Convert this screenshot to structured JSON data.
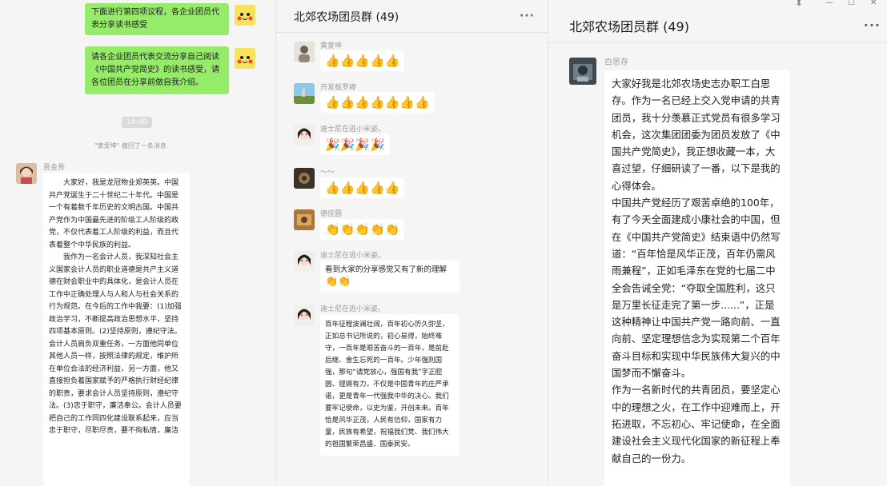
{
  "pane1": {
    "outgoing": [
      {
        "text": "下面进行第四项议程，各企业团员代表分享读书感受"
      },
      {
        "text": "请各企业团员代表交流分享自己阅读《中国共产党简史》的读书感受，请各位团员在分享前做自我介绍。"
      }
    ],
    "time": "14:40",
    "recall": "\"黄爱坤\" 撤回了一条消息",
    "incoming": {
      "name": "吾金骨",
      "paragraphs": [
        "　　大家好，我是龙冠物业郑英英。中国共产党诞生于二十世纪二十年代。中国是一个有着数千年历史的文明古国。中国共产党作为中国最先进的阶级工人阶级的政党，不仅代表着工人阶级的利益，而且代表着整个中华民族的利益。",
        "　　我作为一名会计人员，我深知社会主义国家会计人员的职业道德是共产主义道德在财会职业中的具体化，是会计人员在工作中正确处理人与人和人与社会关系的行为规范。在今后的工作中我要：(1)加强政治学习，不断提高政治思想水平，坚持四项基本原则。(2)坚持原则，遵纪守法。会计人员肩负双重任务，一方面他同单位其他人员一样，按照法律的规定，维护所在单位合法的经济利益，另一方面，他又直接担负着国家赋予的严格执行财经纪律的职责，要求会计人员坚持原则，遵纪守法。(3)忠于职守，廉洁奉公。会计人员要把自己的工作同四化建设联系起来，应当忠于职守，尽职尽责，要不徇私情，廉洁"
      ]
    }
  },
  "pane2": {
    "title": "北郊农场团员群 (49)",
    "more": "···",
    "messages": [
      {
        "name": "黄爱坤",
        "emoji": "👍👍👍👍👍"
      },
      {
        "name": "开发板罗婷",
        "emoji": "👍👍👍👍👍👍👍"
      },
      {
        "name": "迪士尼在逃小米姿。",
        "emoji": "🎉🎉🎉🎉"
      },
      {
        "name": "～～",
        "emoji": "👍👍👍👍👍"
      },
      {
        "name": "德佳圆",
        "emoji": "👏👏👏👏👏"
      },
      {
        "name": "迪士尼在逃小米姿。",
        "text": "看到大家的分享感觉又有了新的理解",
        "emoji": "👏👏"
      },
      {
        "name": "迪士尼在逃小米姿。",
        "text": "百年征程波澜壮阔，百年初心历久弥坚，正如总书记所说的，初心易得，始终难守，一百年是艰苦奋斗的一百年，是前赴后继、舍生忘死的一百年。少年强则国强，那句“请党放心，强国有我”字正腔圆、铿锵有力，不仅是中国青年的庄严承诺，更是青年一代强我中华的决心。我们要牢记使命，以史为鉴，开创未来。百年恰是风华正茂，人民有信仰，国家有力量，民族有希望，祝福我们党、我们伟大的祖国繁荣昌盛、国泰民安。"
      }
    ]
  },
  "pane3": {
    "title": "北郊农场团员群 (49)",
    "more": "···",
    "pin_icon": "pin-icon",
    "message": {
      "name": "白思存",
      "paragraphs": [
        "大家好我是北郊农场史志办职工白思存。作为一名已经上交入党申请的共青团员，我十分羡慕正式党员有很多学习机会，这次集团团委为团员发放了《中国共产党简史》，我正想收藏一本，大喜过望，仔细研读了一番，以下是我的心得体会。",
        "中国共产党经历了艰苦卓绝的100年，有了今天全面建成小康社会的中国，但在《中国共产党简史》结束语中仍然写道：“百年恰是风华正茂，百年仍需风雨兼程”，正如毛泽东在党的七届二中全会告诫全党：“夺取全国胜利，这只是万里长征走完了第一步......”，正是这种精神让中国共产党一路向前、一直向前、坚定理想信念为实现第二个百年奋斗目标和实现中华民族伟大复兴的中国梦而不懈奋斗。",
        "作为一名新时代的共青团员，要坚定心中的理想之火，在工作中迎难而上，开拓进取，不忘初心、牢记使命，在全面建设社会主义现代化国家的新征程上奉献自己的一份力。"
      ]
    }
  }
}
